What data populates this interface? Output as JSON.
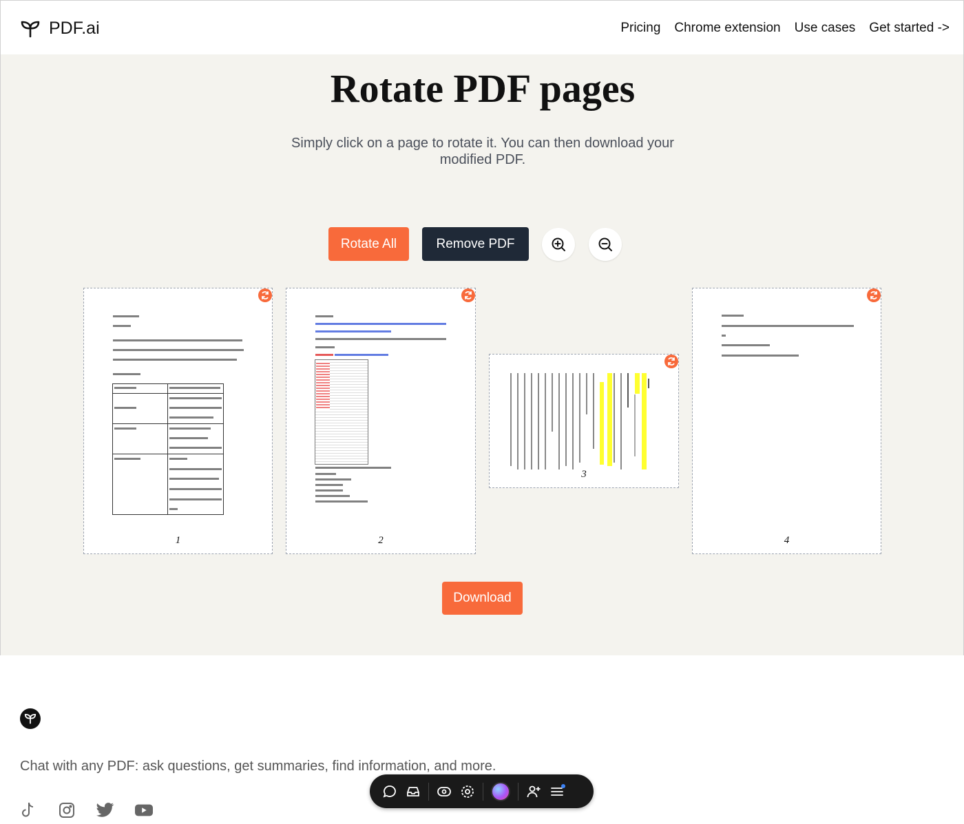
{
  "header": {
    "logo_text": "PDF.ai",
    "nav": [
      "Pricing",
      "Chrome extension",
      "Use cases",
      "Get started ->"
    ]
  },
  "main": {
    "title": "Rotate PDF pages",
    "subtitle": "Simply click on a page to rotate it. You can then download your modified PDF.",
    "rotate_all_label": "Rotate All",
    "remove_pdf_label": "Remove PDF",
    "download_label": "Download",
    "pages": [
      {
        "number": "1",
        "rotation_deg": 0
      },
      {
        "number": "2",
        "rotation_deg": 0
      },
      {
        "number": "3",
        "rotation_deg": 90
      },
      {
        "number": "4",
        "rotation_deg": 0
      }
    ]
  },
  "footer": {
    "tagline": "Chat with any PDF: ask questions, get summaries, find information, and more.",
    "social_icons": [
      "tiktok-icon",
      "instagram-icon",
      "twitter-icon",
      "youtube-icon"
    ]
  },
  "floating_toolbar": {
    "icons": [
      "chat-icon",
      "inbox-icon",
      "eye-icon",
      "target-icon",
      "avatar",
      "add-user-icon",
      "menu-icon"
    ]
  },
  "colors": {
    "accent": "#f86a3b",
    "dark_button": "#1f2937",
    "background": "#f4f3ee"
  }
}
